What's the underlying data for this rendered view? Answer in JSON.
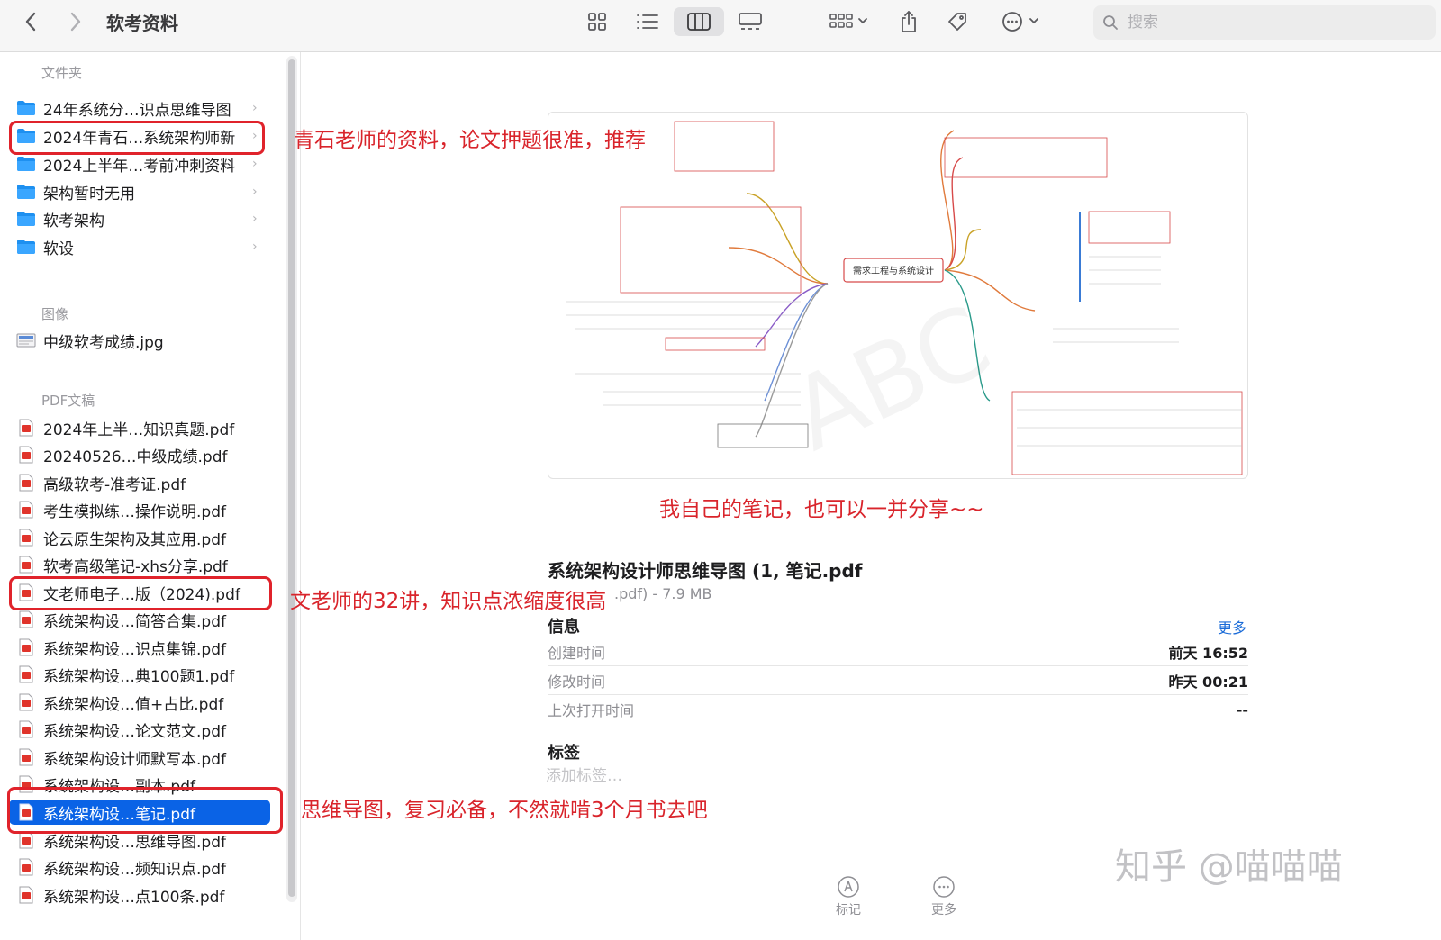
{
  "toolbar": {
    "title": "软考资料",
    "search_placeholder": "搜索"
  },
  "sidebar": {
    "sections": {
      "folders": "文件夹",
      "images": "图像",
      "pdfs": "PDF文稿"
    },
    "folders": [
      {
        "label": "24年系统分…识点思维导图"
      },
      {
        "label": "2024年青石…系统架构师新"
      },
      {
        "label": "2024上半年…考前冲刺资料"
      },
      {
        "label": "架构暂时无用"
      },
      {
        "label": "软考架构"
      },
      {
        "label": "软设"
      }
    ],
    "images": [
      {
        "label": "中级软考成绩.jpg"
      }
    ],
    "pdfs": [
      {
        "label": "2024年上半…知识真题.pdf"
      },
      {
        "label": "20240526…中级成绩.pdf"
      },
      {
        "label": "高级软考-准考证.pdf"
      },
      {
        "label": "考生模拟练…操作说明.pdf"
      },
      {
        "label": "论云原生架构及其应用.pdf"
      },
      {
        "label": "软考高级笔记-xhs分享.pdf"
      },
      {
        "label": "文老师电子…版（2024).pdf"
      },
      {
        "label": "系统架构设…简答合集.pdf"
      },
      {
        "label": "系统架构设…识点集锦.pdf"
      },
      {
        "label": "系统架构设…典100题1.pdf"
      },
      {
        "label": "系统架构设…值+占比.pdf"
      },
      {
        "label": "系统架构设…论文范文.pdf"
      },
      {
        "label": "系统架构设计师默写本.pdf"
      },
      {
        "label": "系统架构设…副本.pdf"
      },
      {
        "label": "系统架构设…笔记.pdf"
      },
      {
        "label": "系统架构设…思维导图.pdf"
      },
      {
        "label": "系统架构设…频知识点.pdf"
      },
      {
        "label": "系统架构设…点100条.pdf"
      }
    ]
  },
  "annotations": {
    "note1": "青石老师的资料，论文押题很准，推荐",
    "note2": "我自己的笔记，也可以一并分享~~",
    "note3": "文老师的32讲，知识点浓缩度很高",
    "note4": "思维导图，复习必备，不然就啃3个月书去吧"
  },
  "preview": {
    "center_node": "需求工程与系统设计"
  },
  "info": {
    "file_name": "系统架构设计师思维导图 (1,  笔记.pdf",
    "file_meta": ".pdf) - 7.9 MB",
    "heading": "信息",
    "more": "更多",
    "rows": [
      {
        "key": "创建时间",
        "value": "前天 16:52"
      },
      {
        "key": "修改时间",
        "value": "昨天 00:21"
      },
      {
        "key": "上次打开时间",
        "value": "--"
      }
    ],
    "tags_heading": "标签",
    "tags_placeholder": "添加标签…"
  },
  "actions": {
    "markup": "标记",
    "more": "更多"
  },
  "watermark": "知乎 @喵喵喵",
  "colors": {
    "accent": "#0a63e6",
    "annotation_red": "#e0232b",
    "link_blue": "#1a6bd8"
  }
}
